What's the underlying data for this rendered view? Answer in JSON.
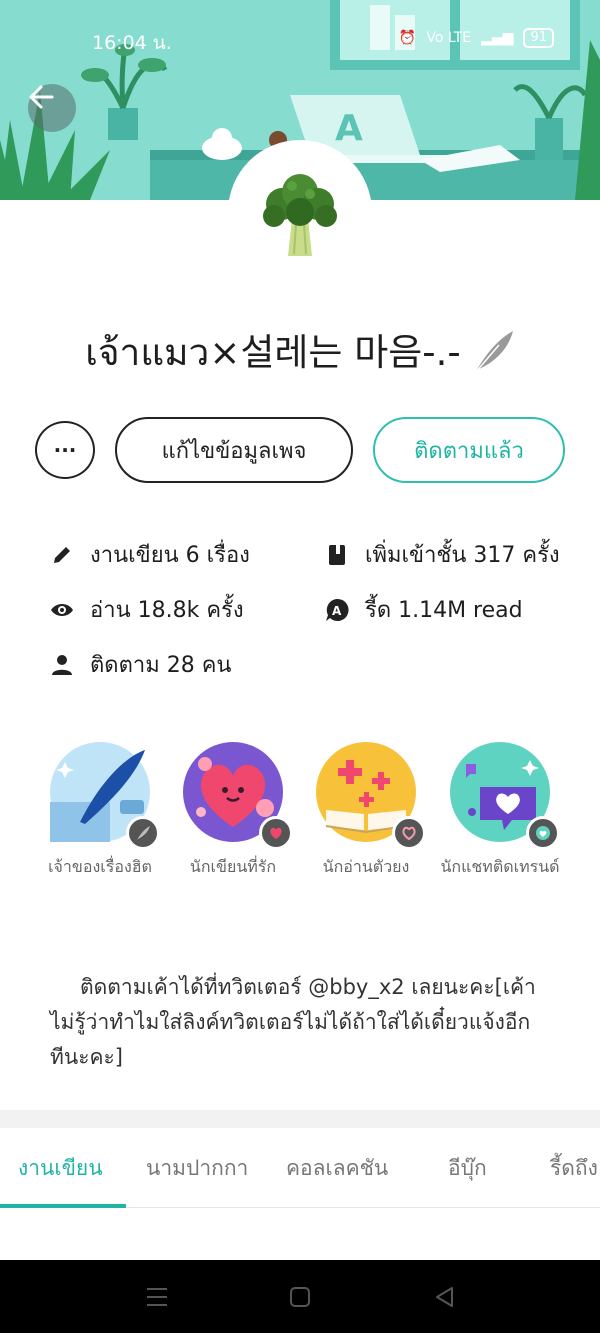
{
  "status_bar": {
    "time": "16:04 น.",
    "carrier": "Vo LTE",
    "battery": "91"
  },
  "profile": {
    "name": "เจ้าแมว⨯설레는 마음-.-"
  },
  "buttons": {
    "more": "···",
    "edit": "แก้ไขข้อมูลเพจ",
    "follow": "ติดตามแล้ว"
  },
  "stats": {
    "works": "งานเขียน 6 เรื่อง",
    "shelf": "เพิ่มเข้าชั้น 317 ครั้ง",
    "views": "อ่าน 18.8k ครั้ง",
    "reads": "รี้ด 1.14M read",
    "followers": "ติดตาม 28 คน"
  },
  "badges": [
    {
      "label": "เจ้าของเรื่องฮิต",
      "color": "#4fa3e6"
    },
    {
      "label": "นักเขียนที่รัก",
      "color": "#7a57d1"
    },
    {
      "label": "นักอ่านตัวยง",
      "color": "#f5b731"
    },
    {
      "label": "นักแชทติดเทรนด์",
      "color": "#3ec9b7"
    }
  ],
  "bio": "ติดตามเค้าได้ที่ทวิตเตอร์ @bby_x2 เลยนะคะ[เค้าไม่รู้ว่าทำไมใส่ลิงค์ทวิตเตอร์ไม่ได้ถ้าใส่ได้เดี๋ยวแจ้งอีกทีนะคะ]",
  "tabs": [
    "งานเขียน",
    "นามปากกา",
    "คอลเลคชัน",
    "อีบุ๊ก",
    "รี้ดถึง"
  ],
  "colors": {
    "accent": "#1fb5a5",
    "banner": "#7fd6c9"
  }
}
